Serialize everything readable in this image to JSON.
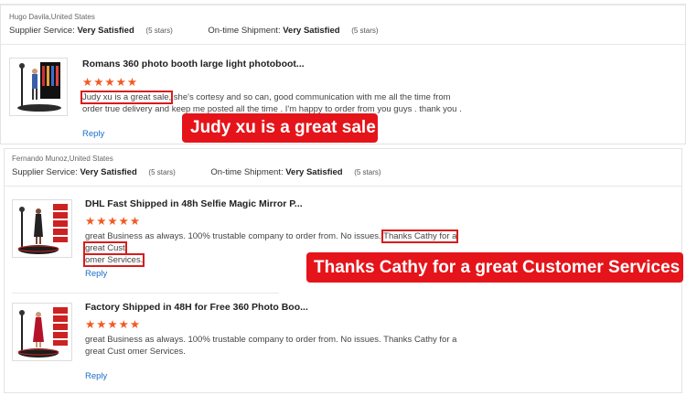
{
  "review1": {
    "author": "Hugo Davila,United States",
    "supplier_label": "Supplier Service:",
    "supplier_value": "Very Satisfied",
    "supplier_stars": "(5 stars)",
    "shipment_label": "On-time Shipment:",
    "shipment_value": "Very Satisfied",
    "shipment_stars": "(5 stars)",
    "item": {
      "title": "Romans 360 photo booth large light photoboot...",
      "stars": "★★★★★",
      "text_highlight": "Judy xu is a great sale,",
      "text_rest": " she's cortesy and so can, good communication with me all the time from order true delivery and keep me posted all the time . I'm happy to order from you guys . thank you .",
      "reply": "Reply"
    },
    "callout": "Judy xu is a great sale"
  },
  "review2": {
    "author": "Fernando Munoz,United States",
    "supplier_label": "Supplier Service:",
    "supplier_value": "Very Satisfied",
    "supplier_stars": "(5 stars)",
    "shipment_label": "On-time Shipment:",
    "shipment_value": "Very Satisfied",
    "shipment_stars": "(5 stars)",
    "items": [
      {
        "title": "DHL Fast Shipped in 48h Selfie Magic Mirror P...",
        "stars": "★★★★★",
        "text_before": "great Business as always. 100% trustable company to order from. No issues.",
        "text_hl1": "Thanks Cathy for a great Cust",
        "text_hl2": "omer Services.",
        "reply": "Reply"
      },
      {
        "title": "Factory Shipped in 48H for Free 360 Photo Boo...",
        "stars": "★★★★★",
        "text": "great Business as always. 100% trustable company to order from. No issues. Thanks Cathy for a great Cust omer Services.",
        "reply": "Reply"
      }
    ],
    "callout": "Thanks Cathy for a great Customer Services"
  },
  "colors": {
    "star": "#f15a22",
    "callout": "#e5141a",
    "link": "#1a6fc7",
    "highlight_border": "#d81c1c"
  }
}
